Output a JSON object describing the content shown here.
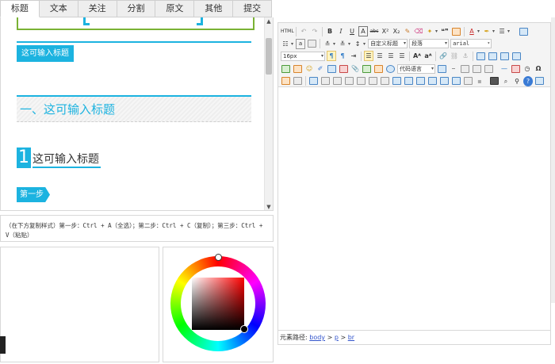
{
  "tabs": [
    {
      "label": "标题",
      "active": true
    },
    {
      "label": "文本",
      "active": false
    },
    {
      "label": "关注",
      "active": false
    },
    {
      "label": "分割",
      "active": false
    },
    {
      "label": "原文",
      "active": false
    },
    {
      "label": "其他",
      "active": false
    },
    {
      "label": "提交",
      "active": false
    }
  ],
  "styles": {
    "style1_label": "这可输入标题",
    "style2_label": "一、这可输入标题",
    "style3_number": "1",
    "style3_label": "这可输入标题",
    "style4_label": "第一步"
  },
  "hint": {
    "text": "（在下方复制样式）第一步：Ctrl + A（全选）；第二步：Ctrl + C（复制）；第三步：Ctrl + V（粘贴）"
  },
  "toolbar": {
    "html_label": "HTML",
    "bold": "B",
    "italic": "I",
    "underline": "U",
    "textbox": "A",
    "strike": "abc",
    "superscript": "X²",
    "subscript": "X₂",
    "quote": "❝❞",
    "font_color": "A",
    "custom_heading": "自定义标题",
    "paragraph": "段落",
    "font_family": "arial",
    "font_size": "16px",
    "code_language": "代码语言"
  },
  "status": {
    "prefix": "元素路径:",
    "path": [
      "body",
      "p",
      "br"
    ],
    "sep": ">"
  },
  "colors": {
    "accent": "#1cb3e0",
    "frame_green": "#7ab234"
  }
}
